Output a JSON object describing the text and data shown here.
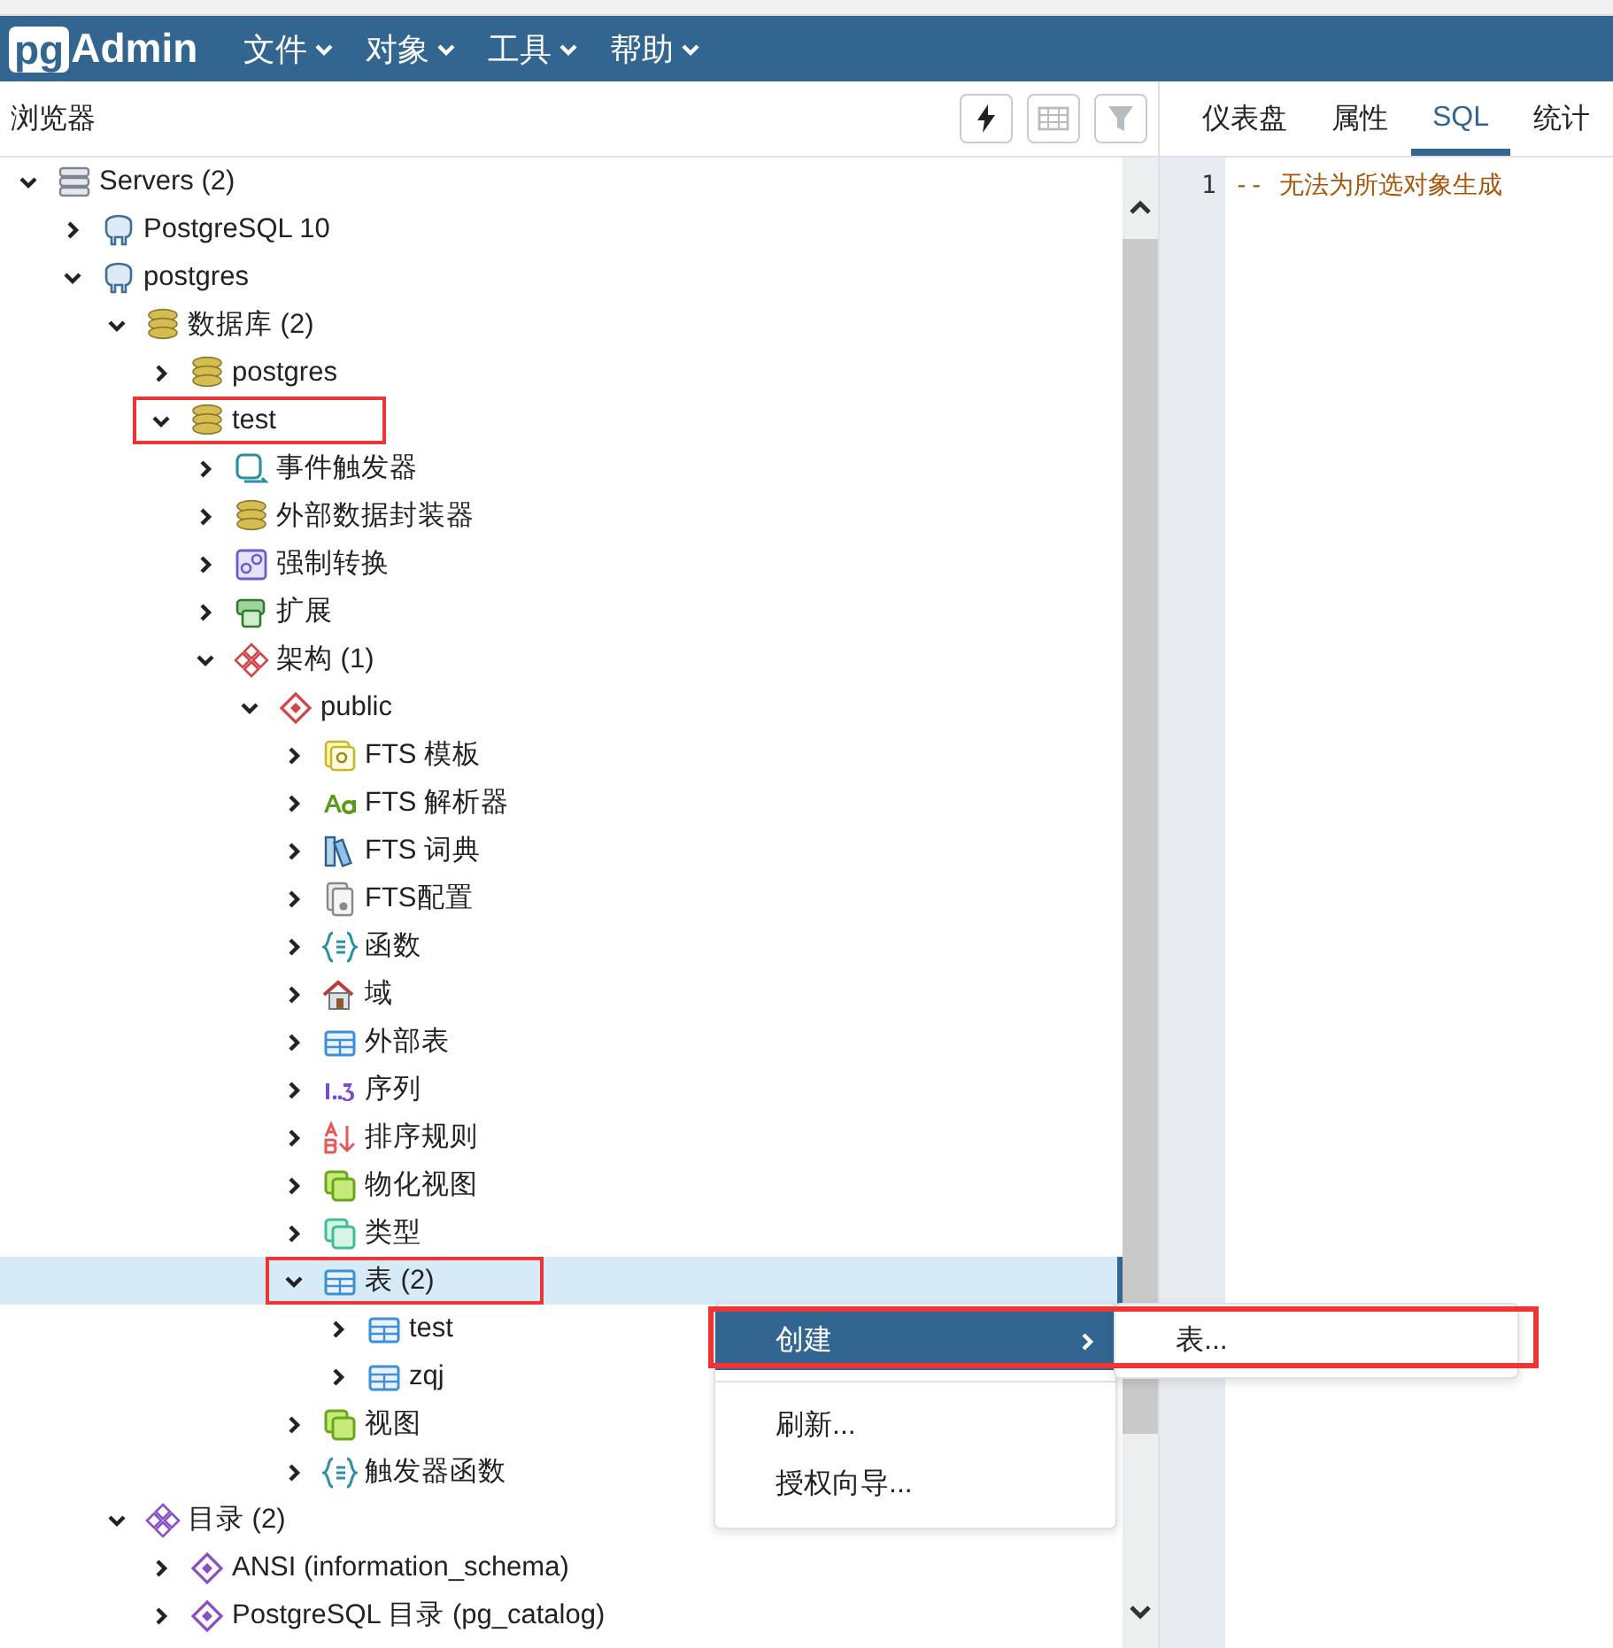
{
  "navbar": {
    "logo_badge": "pg",
    "logo_text": "Admin",
    "menus": [
      {
        "label": "文件"
      },
      {
        "label": "对象"
      },
      {
        "label": "工具"
      },
      {
        "label": "帮助"
      }
    ]
  },
  "browser": {
    "title": "浏览器",
    "toolbar": [
      {
        "kind": "query_tool",
        "disabled": false
      },
      {
        "kind": "view_data",
        "disabled": true
      },
      {
        "kind": "filter",
        "disabled": true
      }
    ],
    "tree": [
      {
        "label": "Servers (2)",
        "kind": "server_group",
        "expanded": true,
        "selected": false,
        "outlined": false,
        "children": [
          {
            "label": "PostgreSQL 10",
            "kind": "server",
            "expanded": false,
            "selected": false,
            "outlined": false
          },
          {
            "label": "postgres",
            "kind": "server",
            "expanded": true,
            "selected": false,
            "outlined": false,
            "children": [
              {
                "label": "数据库 (2)",
                "kind": "database_group",
                "expanded": true,
                "selected": false,
                "outlined": false,
                "children": [
                  {
                    "label": "postgres",
                    "kind": "database",
                    "expanded": false,
                    "selected": false,
                    "outlined": false
                  },
                  {
                    "label": "test",
                    "kind": "database",
                    "expanded": true,
                    "selected": false,
                    "outlined": true,
                    "children": [
                      {
                        "label": "事件触发器",
                        "kind": "event_trigger_group",
                        "expanded": false,
                        "selected": false,
                        "outlined": false
                      },
                      {
                        "label": "外部数据封装器",
                        "kind": "fdw_group",
                        "expanded": false,
                        "selected": false,
                        "outlined": false
                      },
                      {
                        "label": "强制转换",
                        "kind": "cast_group",
                        "expanded": false,
                        "selected": false,
                        "outlined": false
                      },
                      {
                        "label": "扩展",
                        "kind": "extension_group",
                        "expanded": false,
                        "selected": false,
                        "outlined": false
                      },
                      {
                        "label": "架构 (1)",
                        "kind": "schema_group",
                        "expanded": true,
                        "selected": false,
                        "outlined": false,
                        "children": [
                          {
                            "label": "public",
                            "kind": "schema",
                            "expanded": true,
                            "selected": false,
                            "outlined": false,
                            "children": [
                              {
                                "label": "FTS 模板",
                                "kind": "fts_template",
                                "expanded": false,
                                "selected": false,
                                "outlined": false
                              },
                              {
                                "label": "FTS 解析器",
                                "kind": "fts_parser",
                                "expanded": false,
                                "selected": false,
                                "outlined": false
                              },
                              {
                                "label": "FTS 词典",
                                "kind": "fts_dictionary",
                                "expanded": false,
                                "selected": false,
                                "outlined": false
                              },
                              {
                                "label": "FTS配置",
                                "kind": "fts_config",
                                "expanded": false,
                                "selected": false,
                                "outlined": false
                              },
                              {
                                "label": "函数",
                                "kind": "function_group",
                                "expanded": false,
                                "selected": false,
                                "outlined": false
                              },
                              {
                                "label": "域",
                                "kind": "domain_group",
                                "expanded": false,
                                "selected": false,
                                "outlined": false
                              },
                              {
                                "label": "外部表",
                                "kind": "foreign_table_group",
                                "expanded": false,
                                "selected": false,
                                "outlined": false
                              },
                              {
                                "label": "序列",
                                "kind": "sequence_group",
                                "expanded": false,
                                "selected": false,
                                "outlined": false
                              },
                              {
                                "label": "排序规则",
                                "kind": "collation_group",
                                "expanded": false,
                                "selected": false,
                                "outlined": false
                              },
                              {
                                "label": "物化视图",
                                "kind": "mview_group",
                                "expanded": false,
                                "selected": false,
                                "outlined": false
                              },
                              {
                                "label": "类型",
                                "kind": "type_group",
                                "expanded": false,
                                "selected": false,
                                "outlined": false
                              },
                              {
                                "label": "表 (2)",
                                "kind": "table_group",
                                "expanded": true,
                                "selected": true,
                                "outlined": true,
                                "children": [
                                  {
                                    "label": "test",
                                    "kind": "table",
                                    "expanded": false,
                                    "selected": false,
                                    "outlined": false
                                  },
                                  {
                                    "label": "zqj",
                                    "kind": "table",
                                    "expanded": false,
                                    "selected": false,
                                    "outlined": false
                                  }
                                ]
                              },
                              {
                                "label": "视图",
                                "kind": "view_group",
                                "expanded": false,
                                "selected": false,
                                "outlined": false
                              },
                              {
                                "label": "触发器函数",
                                "kind": "trigger_function_group",
                                "expanded": false,
                                "selected": false,
                                "outlined": false
                              }
                            ]
                          }
                        ]
                      }
                    ]
                  }
                ]
              },
              {
                "label": "目录 (2)",
                "kind": "catalog_group",
                "expanded": true,
                "selected": false,
                "outlined": false,
                "children": [
                  {
                    "label": "ANSI (information_schema)",
                    "kind": "catalog",
                    "expanded": false,
                    "selected": false,
                    "outlined": false
                  },
                  {
                    "label": "PostgreSQL 目录 (pg_catalog)",
                    "kind": "catalog",
                    "expanded": false,
                    "selected": false,
                    "outlined": false
                  }
                ]
              }
            ]
          }
        ]
      }
    ]
  },
  "context_menu": {
    "outlined": true,
    "items": [
      {
        "label": "创建",
        "selected": true,
        "has_submenu": true
      },
      {
        "kind": "divider"
      },
      {
        "label": "刷新...",
        "selected": false,
        "has_submenu": false
      },
      {
        "label": "授权向导...",
        "selected": false,
        "has_submenu": false
      }
    ],
    "submenu": [
      {
        "label": "表...",
        "selected": false
      }
    ]
  },
  "panel": {
    "tabs": [
      {
        "label": "仪表盘",
        "selected": false
      },
      {
        "label": "属性",
        "selected": false
      },
      {
        "label": "SQL",
        "selected": true
      },
      {
        "label": "统计",
        "selected": false
      }
    ],
    "code": [
      {
        "line": "1",
        "text": "-- 无法为所选对象生成"
      }
    ]
  }
}
